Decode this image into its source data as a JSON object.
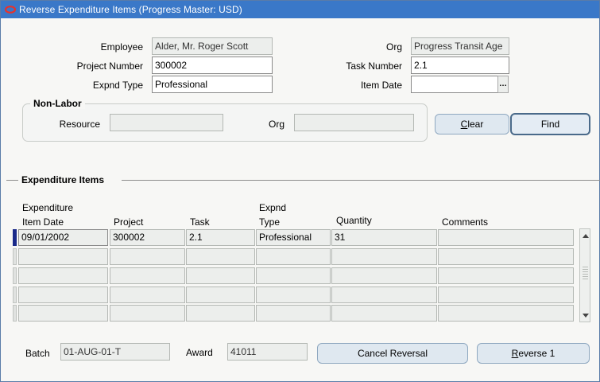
{
  "window": {
    "title": "Reverse Expenditure Items (Progress Master: USD)"
  },
  "header": {
    "employee_label": "Employee",
    "employee_value": "Alder, Mr. Roger Scott",
    "org_label": "Org",
    "org_value": "Progress Transit Age",
    "project_number_label": "Project Number",
    "project_number_value": "300002",
    "task_number_label": "Task Number",
    "task_number_value": "2.1",
    "expnd_type_label": "Expnd Type",
    "expnd_type_value": "Professional",
    "item_date_label": "Item Date",
    "item_date_value": "",
    "lov_glyph": "…"
  },
  "non_labor": {
    "title": "Non-Labor",
    "resource_label": "Resource",
    "resource_value": "",
    "org_label": "Org",
    "org_value": ""
  },
  "buttons": {
    "clear_mnemonic": "C",
    "clear_rest": "lear",
    "find_label": "Find",
    "cancel_reversal_label": "Cancel Reversal",
    "reverse_mnemonic": "R",
    "reverse_rest": "everse 1"
  },
  "items": {
    "section_title": "Expenditure Items",
    "columns": {
      "item_date_line1": "Expenditure",
      "item_date_line2": "Item Date",
      "project": "Project",
      "task": "Task",
      "expnd_type_line1": "Expnd",
      "expnd_type_line2": "Type",
      "quantity": "Quantity",
      "comments": "Comments"
    },
    "rows": [
      {
        "item_date": "09/01/2002",
        "project": "300002",
        "task": "2.1",
        "expnd_type": "Professional",
        "quantity": "31",
        "comments": ""
      },
      {
        "item_date": "",
        "project": "",
        "task": "",
        "expnd_type": "",
        "quantity": "",
        "comments": ""
      },
      {
        "item_date": "",
        "project": "",
        "task": "",
        "expnd_type": "",
        "quantity": "",
        "comments": ""
      },
      {
        "item_date": "",
        "project": "",
        "task": "",
        "expnd_type": "",
        "quantity": "",
        "comments": ""
      },
      {
        "item_date": "",
        "project": "",
        "task": "",
        "expnd_type": "",
        "quantity": "",
        "comments": ""
      }
    ]
  },
  "footer": {
    "batch_label": "Batch",
    "batch_value": "01-AUG-01-T",
    "award_label": "Award",
    "award_value": "41011"
  },
  "icons": {
    "app": "oracle-logo-icon",
    "lov": "ellipsis-icon",
    "scroll_up": "arrow-up-icon",
    "scroll_down": "arrow-down-icon"
  },
  "colors": {
    "titlebar": "#3a78c8",
    "button_fill": "#dfe8f0",
    "current_record": "#1a2a8a"
  }
}
